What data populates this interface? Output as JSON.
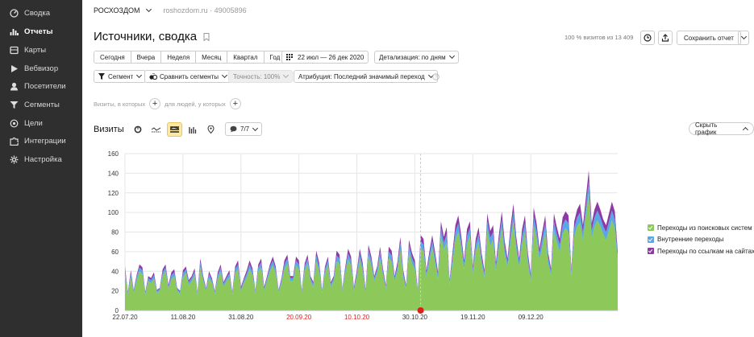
{
  "sidebar": {
    "items": [
      {
        "label": "Сводка",
        "icon": "dashboard-icon",
        "active": false
      },
      {
        "label": "Отчеты",
        "icon": "bar-chart-icon",
        "active": true
      },
      {
        "label": "Карты",
        "icon": "map-icon",
        "active": false
      },
      {
        "label": "Вебвизор",
        "icon": "play-icon",
        "active": false
      },
      {
        "label": "Посетители",
        "icon": "user-icon",
        "active": false
      },
      {
        "label": "Сегменты",
        "icon": "filter-icon",
        "active": false
      },
      {
        "label": "Цели",
        "icon": "target-icon",
        "active": false
      },
      {
        "label": "Интеграции",
        "icon": "puzzle-icon",
        "active": false
      },
      {
        "label": "Настройка",
        "icon": "gear-icon",
        "active": false
      }
    ]
  },
  "header": {
    "counter_name": "РОСХОЗДОМ",
    "counter_site": "roshozdom.ru · 49005896",
    "title": "Источники, сводка",
    "visits_note": "100 % визитов из 13 409",
    "save_label": "Сохранить отчет"
  },
  "toolbar": {
    "periods": [
      "Сегодня",
      "Вчера",
      "Неделя",
      "Месяц",
      "Квартал",
      "Год"
    ],
    "date_range": "22 июл — 26 дек 2020",
    "detail": "Детализация: по дням",
    "segment": "Сегмент",
    "compare": "Сравнить сегменты",
    "accuracy": "Точность: 100%",
    "attribution": "Атрибуция: Последний значимый переход"
  },
  "filters": {
    "visits_where": "Визиты, в которых",
    "people_where": "для людей, у которых"
  },
  "chart_header": {
    "label": "Визиты",
    "series_count": "7/7",
    "hide_label": "Скрыть график"
  },
  "colors": {
    "search": "#8cc85a",
    "internal": "#5aa6e6",
    "links": "#8e3aa6",
    "sidebar_bg": "#2f2f2f"
  },
  "chart_data": {
    "type": "area",
    "stacked": true,
    "ylim": [
      0,
      160
    ],
    "yticks": [
      0,
      20,
      40,
      60,
      80,
      100,
      120,
      140,
      160
    ],
    "xticks": [
      {
        "label": "22.07.20",
        "weekend": false
      },
      {
        "label": "11.08.20",
        "weekend": false
      },
      {
        "label": "31.08.20",
        "weekend": false
      },
      {
        "label": "20.09.20",
        "weekend": true
      },
      {
        "label": "10.10.20",
        "weekend": true
      },
      {
        "label": "30.10.20",
        "weekend": false
      },
      {
        "label": "19.11.20",
        "weekend": false
      },
      {
        "label": "09.12.20",
        "weekend": false
      }
    ],
    "legend_position": "right",
    "grid": true,
    "series": [
      {
        "name": "Переходы из поисковых систем",
        "color_key": "search",
        "values": [
          38,
          16,
          34,
          18,
          30,
          40,
          37,
          16,
          30,
          28,
          32,
          18,
          20,
          35,
          40,
          22,
          32,
          35,
          20,
          17,
          34,
          38,
          26,
          30,
          36,
          16,
          44,
          30,
          20,
          33,
          28,
          17,
          32,
          40,
          24,
          30,
          34,
          16,
          38,
          42,
          20,
          28,
          34,
          42,
          36,
          18,
          40,
          44,
          20,
          30,
          40,
          46,
          38,
          18,
          28,
          42,
          48,
          30,
          30,
          46,
          42,
          18,
          40,
          48,
          30,
          24,
          50,
          40,
          18,
          38,
          46,
          24,
          30,
          50,
          48,
          20,
          38,
          52,
          46,
          20,
          34,
          52,
          40,
          18,
          56,
          46,
          30,
          38,
          54,
          36,
          22,
          54,
          50,
          30,
          40,
          62,
          34,
          22,
          60,
          48,
          42,
          18,
          64,
          60,
          34,
          50,
          64,
          48,
          32,
          76,
          62,
          70,
          26,
          48,
          72,
          80,
          64,
          42,
          68,
          76,
          38,
          60,
          70,
          48,
          34,
          82,
          66,
          72,
          40,
          64,
          84,
          58,
          44,
          70,
          90,
          62,
          44,
          68,
          80,
          48,
          30,
          86,
          74,
          52,
          66,
          80,
          48,
          36,
          82,
          70,
          60,
          78,
          84,
          80,
          36,
          76,
          86,
          90,
          72,
          96,
          120,
          74,
          86,
          92,
          86,
          78,
          72,
          82,
          92,
          84,
          50
        ]
      },
      {
        "name": "Внутренние переходы",
        "color_key": "internal",
        "values": [
          4,
          2,
          4,
          2,
          4,
          4,
          4,
          2,
          3,
          3,
          4,
          2,
          2,
          4,
          4,
          2,
          4,
          4,
          2,
          2,
          4,
          4,
          3,
          3,
          4,
          2,
          5,
          3,
          2,
          4,
          3,
          2,
          4,
          4,
          3,
          3,
          4,
          2,
          4,
          5,
          2,
          3,
          4,
          5,
          4,
          2,
          4,
          5,
          2,
          3,
          4,
          5,
          4,
          2,
          3,
          5,
          5,
          3,
          3,
          5,
          5,
          2,
          5,
          5,
          3,
          3,
          6,
          5,
          2,
          4,
          5,
          3,
          3,
          6,
          5,
          2,
          4,
          6,
          5,
          2,
          4,
          6,
          5,
          2,
          6,
          5,
          3,
          4,
          6,
          4,
          2,
          6,
          6,
          3,
          5,
          7,
          4,
          2,
          7,
          6,
          5,
          2,
          7,
          7,
          4,
          6,
          7,
          6,
          4,
          8,
          7,
          8,
          3,
          6,
          8,
          9,
          7,
          5,
          8,
          8,
          4,
          7,
          8,
          6,
          4,
          9,
          8,
          8,
          5,
          7,
          9,
          7,
          5,
          8,
          10,
          7,
          5,
          8,
          9,
          6,
          4,
          10,
          8,
          6,
          8,
          9,
          6,
          4,
          9,
          8,
          7,
          9,
          9,
          9,
          4,
          8,
          9,
          10,
          8,
          10,
          12,
          8,
          9,
          10,
          9,
          8,
          8,
          9,
          10,
          9,
          6
        ]
      },
      {
        "name": "Переходы по ссылкам на сайтах",
        "color_key": "links",
        "values": [
          3,
          1,
          3,
          1,
          2,
          3,
          3,
          1,
          2,
          2,
          3,
          1,
          1,
          3,
          3,
          2,
          3,
          3,
          1,
          1,
          3,
          3,
          2,
          2,
          3,
          1,
          4,
          2,
          1,
          3,
          2,
          1,
          3,
          3,
          2,
          2,
          3,
          1,
          3,
          4,
          2,
          2,
          3,
          4,
          3,
          1,
          3,
          4,
          2,
          2,
          3,
          4,
          3,
          1,
          2,
          4,
          4,
          2,
          2,
          4,
          4,
          1,
          3,
          4,
          2,
          2,
          5,
          4,
          1,
          3,
          4,
          2,
          2,
          5,
          4,
          1,
          3,
          5,
          4,
          2,
          3,
          5,
          4,
          2,
          5,
          4,
          2,
          3,
          5,
          3,
          2,
          5,
          5,
          2,
          4,
          6,
          3,
          2,
          5,
          5,
          4,
          2,
          6,
          6,
          3,
          4,
          6,
          5,
          3,
          7,
          6,
          7,
          2,
          5,
          7,
          8,
          6,
          4,
          7,
          7,
          3,
          6,
          7,
          5,
          3,
          8,
          7,
          7,
          4,
          6,
          8,
          6,
          4,
          7,
          9,
          6,
          4,
          7,
          8,
          5,
          3,
          9,
          7,
          5,
          7,
          8,
          5,
          3,
          8,
          7,
          6,
          8,
          8,
          8,
          3,
          7,
          8,
          9,
          7,
          9,
          11,
          7,
          8,
          9,
          8,
          7,
          7,
          8,
          9,
          8,
          5
        ]
      }
    ]
  }
}
